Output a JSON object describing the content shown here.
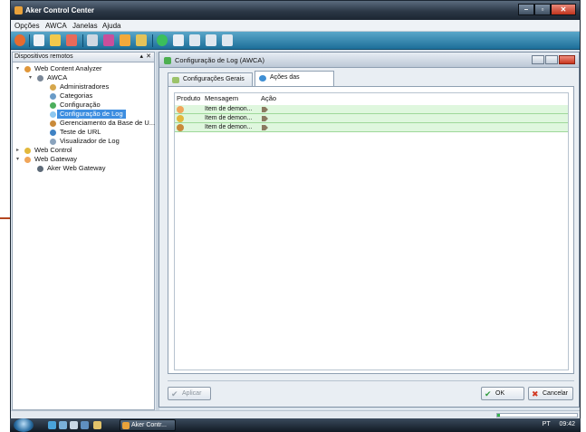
{
  "window": {
    "title": "Aker Control Center",
    "controls": {
      "minimize": "–",
      "maximize": "▫",
      "close": "✕"
    }
  },
  "menu": [
    "Opções",
    "AWCA",
    "Janelas",
    "Ajuda"
  ],
  "toolbar_icons": [
    "power-icon",
    "document-icon",
    "document-icon",
    "document-icon",
    "gear-icon",
    "users-icon",
    "star-icon",
    "connect-icon",
    "refresh-icon",
    "document-icon",
    "document-icon",
    "arrow-icon",
    "arrow-icon"
  ],
  "left_panel": {
    "title": "Dispositivos remotos",
    "pin": "▴",
    "close": "✕",
    "tree": [
      {
        "label": "Web Content Analyzer",
        "icon": "gear-icon",
        "expanded": true
      },
      {
        "label": "AWCA",
        "icon": "server-icon",
        "expanded": true
      },
      {
        "label": "Administradores",
        "icon": "user-icon"
      },
      {
        "label": "Categorias",
        "icon": "list-icon"
      },
      {
        "label": "Configuração",
        "icon": "gear-icon"
      },
      {
        "label": "Configuração de Log",
        "icon": "log-icon",
        "selected": true
      },
      {
        "label": "Gerenciamento da Base de U...",
        "icon": "database-icon"
      },
      {
        "label": "Teste de URL",
        "icon": "url-icon"
      },
      {
        "label": "Visualizador de Log",
        "icon": "log-icon"
      },
      {
        "label": "Web Control",
        "icon": "gear-icon",
        "expanded": false
      },
      {
        "label": "Web Gateway",
        "icon": "gateway-icon",
        "expanded": true
      },
      {
        "label": "Aker Web Gateway",
        "icon": "server-icon"
      }
    ]
  },
  "child_window": {
    "title": "Configuração de Log (AWCA)",
    "tabs": [
      {
        "label": "Configurações Gerais",
        "active": false
      },
      {
        "label": "Ações das Mensagens",
        "active": true
      }
    ],
    "grid": {
      "columns": [
        "Produto",
        "Mensagem",
        "Ação"
      ],
      "rows": [
        {
          "product_icon": "awca-icon",
          "message": "Item de demon...",
          "action_icon": "action-icon"
        },
        {
          "product_icon": "web-control-icon",
          "message": "Item de demon...",
          "action_icon": "action-icon"
        },
        {
          "product_icon": "gateway-icon",
          "message": "Item de demon...",
          "action_icon": "action-icon"
        }
      ]
    },
    "buttons": {
      "apply": "Aplicar",
      "ok": "OK",
      "cancel": "Cancelar"
    }
  },
  "taskbar": {
    "task_label": "Aker Contr...",
    "tray": {
      "lang": "PT",
      "time": "09:42"
    }
  },
  "colors": {
    "title_bar": "#2c3846",
    "toolbar": "#1d6f99",
    "selection": "#3d8ee0",
    "grid_row": "#dff7de"
  }
}
